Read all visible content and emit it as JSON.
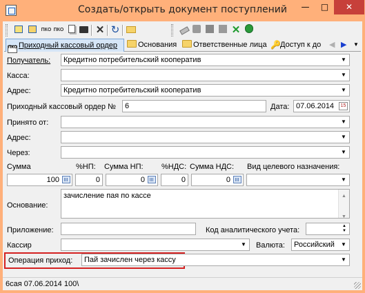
{
  "window": {
    "title": "Создать/открыть документ поступлений",
    "minimize": "—",
    "maximize": "□",
    "close": "✕"
  },
  "toolbar": {
    "buttons": [
      {
        "icon": "form-icon"
      },
      {
        "icon": "form-icon"
      },
      {
        "icon": "pko-icon",
        "text": "ПКО"
      },
      {
        "icon": "pko-icon",
        "text": "ПКО"
      },
      {
        "icon": "copy-icon"
      },
      {
        "icon": "folder-icon"
      },
      {
        "icon": "delete-icon",
        "glyph": "✕"
      },
      {
        "icon": "refresh-icon",
        "glyph": "↻"
      },
      {
        "icon": "open-folder-icon"
      },
      {
        "icon": "eraser-icon"
      },
      {
        "icon": "gray-icon"
      },
      {
        "icon": "gray-icon"
      },
      {
        "icon": "gray-icon"
      },
      {
        "icon": "check-icon",
        "glyph": "✕"
      },
      {
        "icon": "lock-icon"
      }
    ]
  },
  "tabs": [
    {
      "label": "Приходный кассовый ордер",
      "icon": "pko-icon",
      "active": true
    },
    {
      "label": "Основания",
      "icon": "folder-icon"
    },
    {
      "label": "Ответственные лица",
      "icon": "folder-icon"
    },
    {
      "label": "Доступ к до",
      "icon": "key-icon"
    }
  ],
  "form": {
    "recipient_label": "Получатель:",
    "recipient_value": "Кредитно потребительский кооператив",
    "cashbox_label": "Касса:",
    "cashbox_value": "",
    "address_label": "Адрес:",
    "address_value": "Кредитно потребительский кооператив",
    "order_label": "Приходный кассовый ордер №",
    "order_number": "6",
    "date_label": "Дата:",
    "date_value": "07.06.2014",
    "date_icon_text": "15",
    "accepted_from_label": "Принято от:",
    "accepted_from_value": "",
    "address2_label": "Адрес:",
    "address2_value": "",
    "via_label": "Через:",
    "via_value": "",
    "amount_label": "Сумма",
    "np_pct_label": "%НП:",
    "np_sum_label": "Сумма НП:",
    "vat_pct_label": "%НДС:",
    "vat_sum_label": "Сумма НДС:",
    "purpose_label": "Вид целевого назначения:",
    "amount_value": "100",
    "np_pct_value": "0",
    "np_sum_value": "0",
    "vat_pct_value": "0",
    "vat_sum_value": "0",
    "purpose_value": "",
    "basis_label": "Основание:",
    "basis_value": "зачисление пая по кассе",
    "attachment_label": "Приложение:",
    "attachment_value": "",
    "analytic_code_label": "Код аналитического учета:",
    "analytic_code_value": "",
    "cashier_label": "Кассир",
    "cashier_value": "",
    "currency_label": "Валюта:",
    "currency_value": "Российский",
    "operation_label": "Операция приход:",
    "operation_value": "Пай зачислен через кассу"
  },
  "status": {
    "text": "6сая 07.06.2014 100\\"
  },
  "colors": {
    "title_bar": "#ffb07a",
    "close_button": "#c7403a",
    "highlight_border": "#d42020",
    "active_tab": "#d6e6f7"
  }
}
